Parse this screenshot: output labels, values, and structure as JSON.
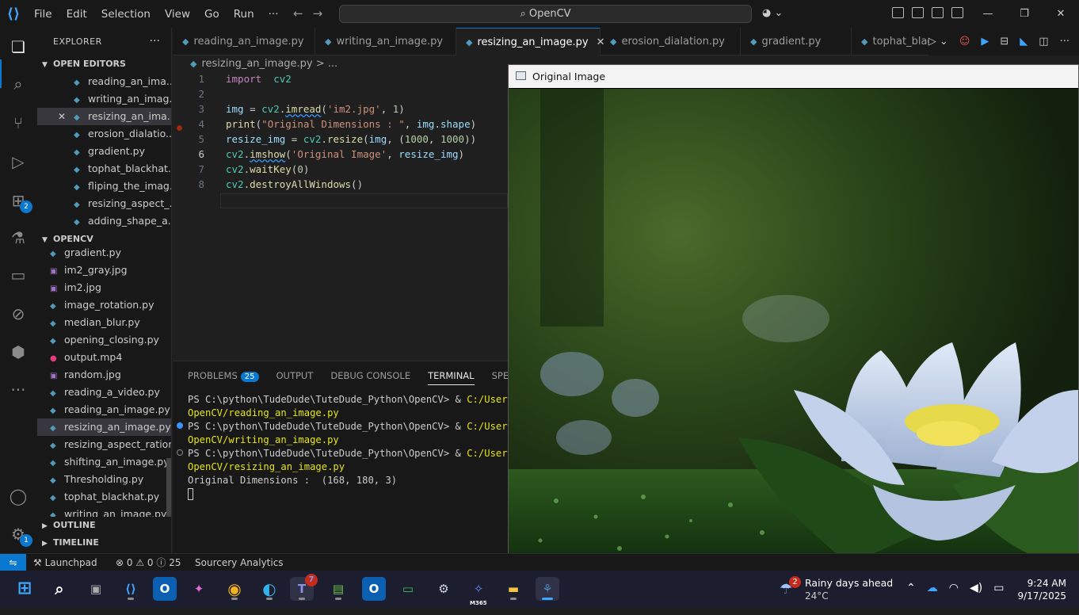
{
  "titlebar": {
    "menu": [
      "File",
      "Edit",
      "Selection",
      "View",
      "Go",
      "Run",
      "···"
    ],
    "search": "OpenCV"
  },
  "activity_bar": {
    "extensions_badge": "2",
    "settings_badge": "1"
  },
  "explorer": {
    "title": "EXPLORER",
    "more": "···",
    "open_editors_header": "OPEN EDITORS",
    "open_editors": [
      "reading_an_ima...",
      "writing_an_imag...",
      "resizing_an_ima...",
      "erosion_dialatio...",
      "gradient.py",
      "tophat_blackhat....",
      "fliping_the_imag...",
      "resizing_aspect_...",
      "adding_shape_a..."
    ],
    "workspace_header": "OPENCV",
    "files": [
      "gradient.py",
      "im2_gray.jpg",
      "im2.jpg",
      "image_rotation.py",
      "median_blur.py",
      "opening_closing.py",
      "output.mp4",
      "random.jpg",
      "reading_a_video.py",
      "reading_an_image.py",
      "resizing_an_image.py",
      "resizing_aspect_ration...",
      "shifting_an_image.py",
      "Thresholding.py",
      "tophat_blackhat.py",
      "writing_an_image.py"
    ],
    "outline_header": "OUTLINE",
    "timeline_header": "TIMELINE"
  },
  "tabs": [
    "reading_an_image.py",
    "writing_an_image.py",
    "resizing_an_image.py",
    "erosion_dialation.py",
    "gradient.py",
    "tophat_blac"
  ],
  "breadcrumb": {
    "file": "resizing_an_image.py",
    "sep": "> ..."
  },
  "code": {
    "line_numbers": [
      "1",
      "2",
      "3",
      "4",
      "5",
      "6",
      "7",
      "8"
    ],
    "lines": [
      [
        [
          "kw",
          "import"
        ],
        [
          "",
          "  "
        ],
        [
          "mod",
          "cv2"
        ]
      ],
      [],
      [
        [
          "var",
          "img"
        ],
        [
          "",
          " = "
        ],
        [
          "mod",
          "cv2"
        ],
        [
          "",
          "."
        ],
        [
          "fn squig",
          "imread"
        ],
        [
          "",
          "("
        ],
        [
          "str",
          "'im2.jpg'"
        ],
        [
          "",
          ", "
        ],
        [
          "num",
          "1"
        ],
        [
          "",
          ")"
        ]
      ],
      [
        [
          "fn",
          "print"
        ],
        [
          "",
          "("
        ],
        [
          "str",
          "\"Original Dimensions : \""
        ],
        [
          "",
          ", "
        ],
        [
          "var",
          "img"
        ],
        [
          "",
          "."
        ],
        [
          "var",
          "shape"
        ],
        [
          "",
          ")"
        ]
      ],
      [
        [
          "var",
          "resize_img"
        ],
        [
          "",
          " = "
        ],
        [
          "mod",
          "cv2"
        ],
        [
          "",
          "."
        ],
        [
          "fn",
          "resize"
        ],
        [
          "",
          "("
        ],
        [
          "var",
          "img"
        ],
        [
          "",
          ", ("
        ],
        [
          "num",
          "1000"
        ],
        [
          "",
          ", "
        ],
        [
          "num",
          "1000"
        ],
        [
          "",
          "))"
        ]
      ],
      [
        [
          "mod",
          "cv2"
        ],
        [
          "",
          "."
        ],
        [
          "fn squig",
          "imshow"
        ],
        [
          "",
          "("
        ],
        [
          "str",
          "'Original Image'"
        ],
        [
          "",
          ", "
        ],
        [
          "var",
          "resize_img"
        ],
        [
          "",
          ")"
        ]
      ],
      [
        [
          "mod",
          "cv2"
        ],
        [
          "",
          "."
        ],
        [
          "fn",
          "waitKey"
        ],
        [
          "",
          "("
        ],
        [
          "num",
          "0"
        ],
        [
          "",
          ")"
        ]
      ],
      [
        [
          "mod",
          "cv2"
        ],
        [
          "",
          "."
        ],
        [
          "fn",
          "destroyAllWindows"
        ],
        [
          "",
          "()"
        ]
      ]
    ]
  },
  "panel": {
    "tabs": [
      "PROBLEMS",
      "OUTPUT",
      "DEBUG CONSOLE",
      "TERMINAL",
      "SPELL CHEC"
    ],
    "problems_count": "25",
    "terminal": {
      "prompt": "PS C:\\python\\TudeDude\\TuteDude_Python\\OpenCV> ",
      "amp": "& ",
      "path_start": "C:/Users/C",
      "cmds": [
        "OpenCV/reading_an_image.py",
        "OpenCV/writing_an_image.py",
        "OpenCV/resizing_an_image.py"
      ],
      "output": "Original Dimensions :  (168, 180, 3)"
    }
  },
  "image_window": {
    "title": "Original Image"
  },
  "statusbar": {
    "launchpad": "Launchpad",
    "errors": "0",
    "warnings": "0",
    "info": "25",
    "sourcery": "Sourcery Analytics"
  },
  "taskbar": {
    "teams_badge": "7",
    "m365_label": "M365",
    "weather_badge": "2",
    "weather_title": "Rainy days ahead",
    "weather_temp": "24°C",
    "time": "9:24 AM",
    "date": "9/17/2025"
  },
  "colors": {
    "accent": "#0b78d0",
    "python_icon": "#519aba",
    "image_icon": "#a074c4",
    "video_icon": "#e5397f"
  }
}
